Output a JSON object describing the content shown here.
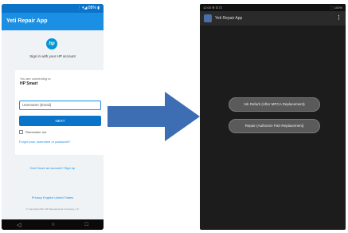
{
  "left_phone": {
    "status": "⋮ ▾◢ 88% ▮",
    "app_title": "Yeti Repair App",
    "hp_logo": "hp",
    "signin_text": "Sign in with your HP account",
    "connecting_text": "You are connecting to",
    "app_name": "HP Smart",
    "username_placeholder": "Username (Email)",
    "next_label": "NEXT",
    "remember_label": "Remember me",
    "forgot_link": "Forgot your username or password?",
    "signup_link": "Don't have an account? Sign up",
    "privacy_link": "Privacy  English United States",
    "copyright": "© Copyright 2017 HP Development Company, L.P.",
    "nav": {
      "back": "◁",
      "home": "○",
      "recents": "□"
    }
  },
  "right_phone": {
    "status_left": "12:00 ⚙ ⊡ ⊡",
    "status_right": "⬚ 100%",
    "app_title": "Yeti Repair App",
    "menu_icon": "⋮",
    "buttons": [
      "Ink Refurb (After MPCA Replacement)",
      "Repair (Authorize Part Replacement)"
    ]
  },
  "colors": {
    "hp_blue": "#0b74c9",
    "arrow_blue": "#3d6db3"
  }
}
